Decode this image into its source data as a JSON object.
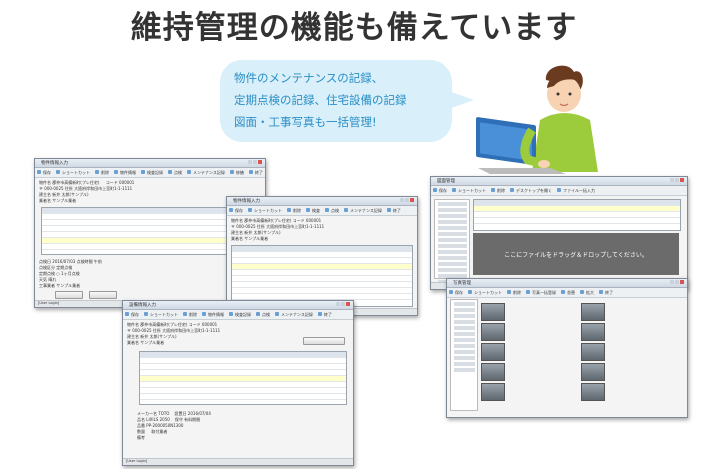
{
  "headline": "維持管理の機能も備えています",
  "bubble": {
    "lines": [
      "物件のメンテナンスの記録、",
      "定期点検の記録、住宅設備の記録",
      "図面・工事写真も一括管理!"
    ]
  },
  "window_right_drop_text": "ここにファイルをドラッグ＆ドロップしてください。"
}
